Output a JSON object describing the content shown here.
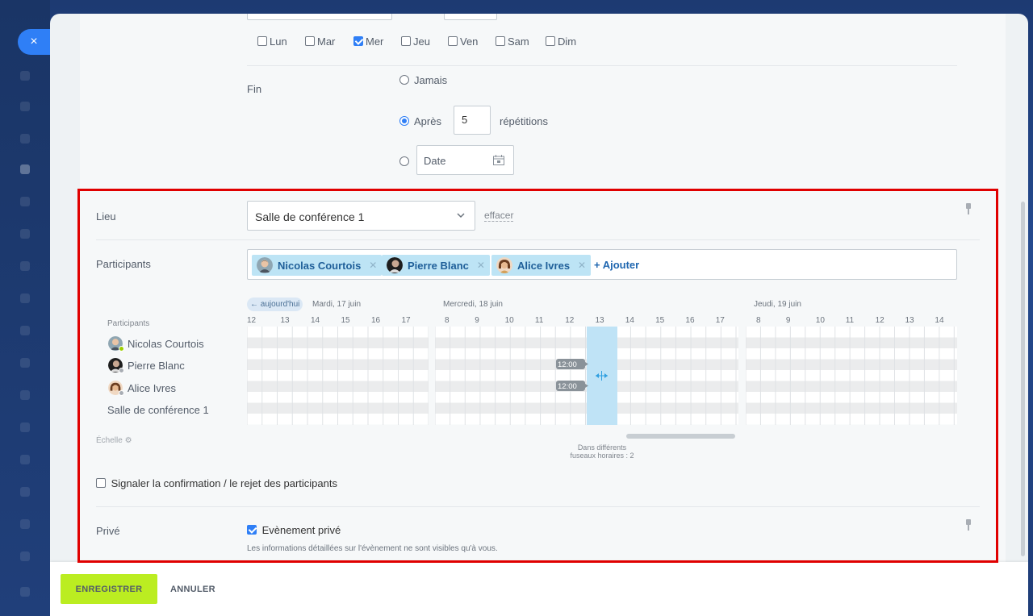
{
  "close_label": "×",
  "weekdays": [
    {
      "label": "Lun",
      "checked": false
    },
    {
      "label": "Mar",
      "checked": false
    },
    {
      "label": "Mer",
      "checked": true
    },
    {
      "label": "Jeu",
      "checked": false
    },
    {
      "label": "Ven",
      "checked": false
    },
    {
      "label": "Sam",
      "checked": false
    },
    {
      "label": "Dim",
      "checked": false
    }
  ],
  "end": {
    "label": "Fin",
    "never": "Jamais",
    "after": "Après",
    "after_value": "5",
    "after_unit": "répétitions",
    "date_placeholder": "Date",
    "selected": "after"
  },
  "location": {
    "label": "Lieu",
    "value": "Salle de conférence 1",
    "clear": "effacer"
  },
  "participants": {
    "label": "Participants",
    "tags": [
      "Nicolas Courtois",
      "Pierre Blanc",
      "Alice Ivres"
    ],
    "add": "+ Ajouter"
  },
  "planner": {
    "today_btn": "← aujourd'hui",
    "days": [
      "Mardi, 17 juin",
      "Mercredi, 18 juin",
      "Jeudi, 19 juin"
    ],
    "ticks_day1": [
      "12",
      "13",
      "14",
      "15",
      "16",
      "17"
    ],
    "ticks_day2": [
      "8",
      "9",
      "10",
      "11",
      "12",
      "13",
      "14",
      "15",
      "16",
      "17"
    ],
    "ticks_day3": [
      "8",
      "9",
      "10",
      "11",
      "12",
      "13",
      "14"
    ],
    "rows_header": "Participants",
    "rows": [
      "Nicolas Courtois",
      "Pierre Blanc",
      "Alice Ivres",
      "Salle de conférence 1"
    ],
    "busy_label": "12:00",
    "scale": "Échelle",
    "timezones_line1": "Dans différents",
    "timezones_line2": "fuseaux horaires : 2"
  },
  "notify_label": "Signaler la confirmation / le rejet des participants",
  "private": {
    "label": "Privé",
    "checkbox": "Evènement privé",
    "checked": true,
    "hint": "Les informations détaillées sur l'évènement ne sont visibles qu'à vous."
  },
  "footer": {
    "save": "ENREGISTRER",
    "cancel": "ANNULER"
  },
  "colors": {
    "accent": "#2f7ff6",
    "save_bg": "#bbed21",
    "highlight": "#e00000",
    "tag_bg": "#bde4f5",
    "selection": "#bfe3f6"
  }
}
